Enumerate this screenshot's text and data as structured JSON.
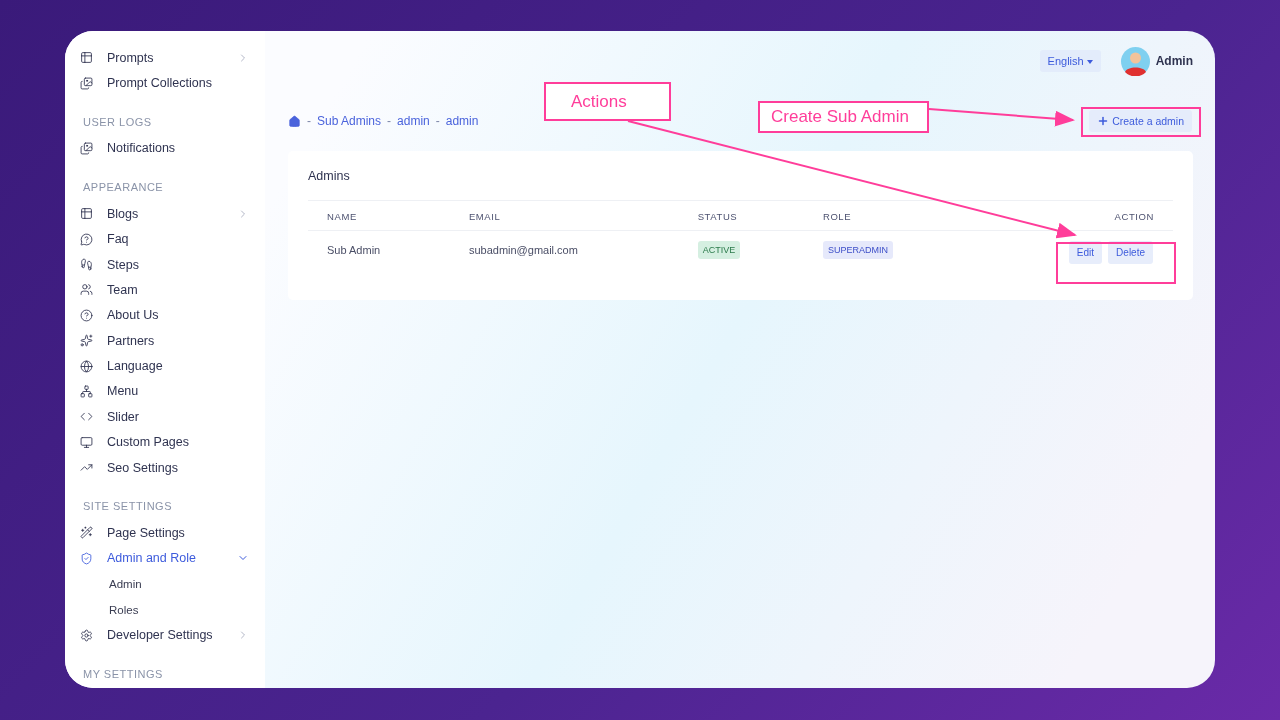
{
  "sidebar": {
    "sections": [
      {
        "items": [
          {
            "label": "Prompts",
            "kind": "group",
            "expanded": false,
            "selected": false
          },
          {
            "label": "Prompt Collections",
            "kind": "link",
            "selected": false
          }
        ]
      },
      {
        "title": "USER LOGS",
        "items": [
          {
            "label": "Notifications",
            "kind": "link",
            "selected": false
          }
        ]
      },
      {
        "title": "APPEARANCE",
        "items": [
          {
            "label": "Blogs",
            "kind": "group",
            "expanded": false,
            "selected": false
          },
          {
            "label": "Faq",
            "kind": "link",
            "selected": false
          },
          {
            "label": "Steps",
            "kind": "link",
            "selected": false
          },
          {
            "label": "Team",
            "kind": "link",
            "selected": false
          },
          {
            "label": "About Us",
            "kind": "link",
            "selected": false
          },
          {
            "label": "Partners",
            "kind": "link",
            "selected": false
          },
          {
            "label": "Language",
            "kind": "link",
            "selected": false
          },
          {
            "label": "Menu",
            "kind": "link",
            "selected": false
          },
          {
            "label": "Slider",
            "kind": "link",
            "selected": false
          },
          {
            "label": "Custom Pages",
            "kind": "link",
            "selected": false
          },
          {
            "label": "Seo Settings",
            "kind": "link",
            "selected": false
          }
        ]
      },
      {
        "title": "SITE SETTINGS",
        "items": [
          {
            "label": "Page Settings",
            "kind": "link",
            "selected": false
          },
          {
            "label": "Admin and Role",
            "kind": "group",
            "expanded": true,
            "selected": true,
            "children": [
              {
                "label": "Admin"
              },
              {
                "label": "Roles"
              }
            ]
          },
          {
            "label": "Developer Settings",
            "kind": "group",
            "expanded": false,
            "selected": false
          }
        ]
      },
      {
        "title": "MY SETTINGS"
      }
    ]
  },
  "header": {
    "language": "English",
    "user": "Admin"
  },
  "breadcrumb": [
    {
      "separator": "-",
      "label": "Sub Admins"
    },
    {
      "separator": "-",
      "label": "admin"
    },
    {
      "separator": "-",
      "label": "admin"
    }
  ],
  "create_button": "Create a admin",
  "card": {
    "title": "Admins",
    "table": {
      "columns": [
        "NAME",
        "EMAIL",
        "STATUS",
        "ROLE",
        "ACTION"
      ],
      "rows": [
        {
          "name": "Sub Admin",
          "email": "subadmin@gmail.com",
          "status": "ACTIVE",
          "role": "SUPERADMIN",
          "actions": [
            "Edit",
            "Delete"
          ]
        }
      ]
    }
  },
  "annotations": [
    {
      "text": "Actions"
    },
    {
      "text": "Create Sub Admin"
    }
  ]
}
